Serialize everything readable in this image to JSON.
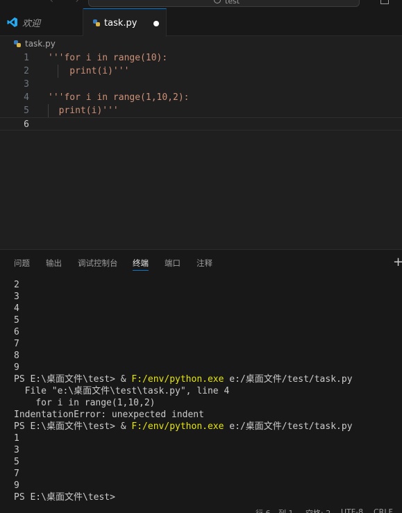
{
  "titlebar": {
    "search_text": "test",
    "nav_arrows": "‹ ›"
  },
  "tabs": [
    {
      "label": "欢迎"
    },
    {
      "label": "task.py"
    }
  ],
  "breadcrumb": {
    "file": "task.py"
  },
  "editor": {
    "lines": [
      {
        "number": "1",
        "text": "'''for i in range(10):"
      },
      {
        "number": "2",
        "text": "    print(i)'''"
      },
      {
        "number": "3",
        "text": ""
      },
      {
        "number": "4",
        "text": "'''for i in range(1,10,2):"
      },
      {
        "number": "5",
        "text": "  print(i)'''"
      },
      {
        "number": "6",
        "text": ""
      }
    ]
  },
  "panel": {
    "tabs": [
      "问题",
      "输出",
      "调试控制台",
      "终端",
      "端口",
      "注释"
    ],
    "add_icon": "+"
  },
  "terminal": {
    "lines": [
      {
        "text": "2"
      },
      {
        "text": "3"
      },
      {
        "text": "4"
      },
      {
        "text": "5"
      },
      {
        "text": "6"
      },
      {
        "text": "7"
      },
      {
        "text": "8"
      },
      {
        "text": "9"
      },
      {
        "prompt": "PS E:\\桌面文件\\test> & ",
        "cmd": "F:/env/python.exe",
        "rest": " e:/桌面文件/test/task.py"
      },
      {
        "text": "  File \"e:\\桌面文件\\test\\task.py\", line 4"
      },
      {
        "text": "    for i in range(1,10,2)"
      },
      {
        "text": "IndentationError: unexpected indent"
      },
      {
        "prompt": "PS E:\\桌面文件\\test> & ",
        "cmd": "F:/env/python.exe",
        "rest": " e:/桌面文件/test/task.py"
      },
      {
        "text": "1"
      },
      {
        "text": "3"
      },
      {
        "text": "5"
      },
      {
        "text": "7"
      },
      {
        "text": "9"
      },
      {
        "text": "PS E:\\桌面文件\\test>"
      }
    ]
  },
  "statusbar": {
    "line": "行 6",
    "col": "列 1",
    "spaces": "空格: 2",
    "encoding": "UTF-8",
    "eol": "CRLF"
  },
  "colors": {
    "accent": "#0078d4",
    "string": "#ce9178",
    "terminal_cmd": "#e5e510",
    "vscode_blue": "#23a9f2"
  }
}
